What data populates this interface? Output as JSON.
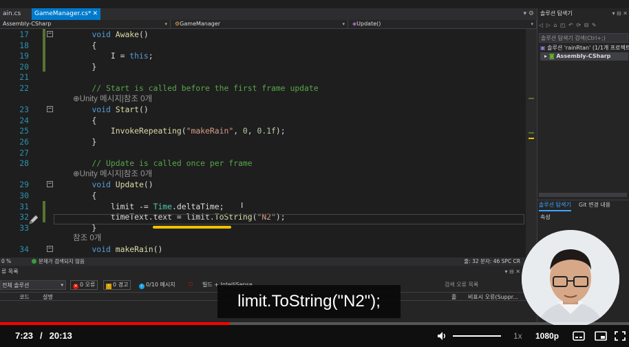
{
  "tabs": [
    {
      "label": "ain.cs"
    },
    {
      "label": "GameManager.cs*"
    }
  ],
  "tabbar_right": "▾ ⚙",
  "navbar": {
    "project": "Assembly-CSharp",
    "class": "GameManager",
    "method": "Update()"
  },
  "editor": {
    "lines": [
      {
        "n": "17",
        "text": "    void Awake()"
      },
      {
        "n": "18",
        "text": "    {"
      },
      {
        "n": "19",
        "text": "        I = this;"
      },
      {
        "n": "20",
        "text": "    }"
      },
      {
        "n": "21",
        "text": ""
      },
      {
        "n": "22",
        "text": "    // Start is called before the first frame update"
      },
      {
        "lens": "⊕Unity 메시지|참조 0개"
      },
      {
        "n": "23",
        "text": "    void Start()"
      },
      {
        "n": "24",
        "text": "    {"
      },
      {
        "n": "25",
        "text": "        InvokeRepeating(\"makeRain\", 0, 0.1f);"
      },
      {
        "n": "26",
        "text": "    }"
      },
      {
        "n": "27",
        "text": ""
      },
      {
        "n": "28",
        "text": "    // Update is called once per frame"
      },
      {
        "lens": "⊕Unity 메시지|참조 0개"
      },
      {
        "n": "29",
        "text": "    void Update()"
      },
      {
        "n": "30",
        "text": "    {"
      },
      {
        "n": "31",
        "text": "        limit -= Time.deltaTime;"
      },
      {
        "n": "32",
        "text": "        timeText.text = limit.ToString(\"N2\");"
      },
      {
        "n": "33",
        "text": "    }"
      },
      {
        "lens": "참조 0개"
      },
      {
        "n": "34",
        "text": "    void makeRain()"
      }
    ]
  },
  "statusbar": {
    "zoom": "0 %",
    "issues": "문제가 검색되지 않음",
    "position": "줄: 32   문자: 46   SPC   CR"
  },
  "errorlist": {
    "title": "류 목록",
    "scope": "전체 솔루션",
    "errors": "0 오류",
    "warnings": "0 경고",
    "messages": "0/10 메시지",
    "build": "빌드 + IntelliSense",
    "search_placeholder": "검색 오류 목록",
    "columns": {
      "code": "코드",
      "desc": "설명",
      "line": "줄",
      "suppress": "비표시 오류(Suppr..."
    }
  },
  "solution_explorer": {
    "title": "솔루션 탐색기",
    "search_placeholder": "솔루션 탐색기 검색(Ctrl+;)",
    "solution": "솔루션 'rainRtan' (1/1개 프로젝트)",
    "project": "Assembly-CSharp",
    "tab1": "솔루션 탐색기",
    "tab2": "Git 변경 내용",
    "properties": "속성"
  },
  "caption": "limit.ToString(\"N2\");",
  "player": {
    "current_time": "7:23",
    "duration": "20:13",
    "progress": 0.365,
    "speed": "1x",
    "quality": "1080p"
  }
}
